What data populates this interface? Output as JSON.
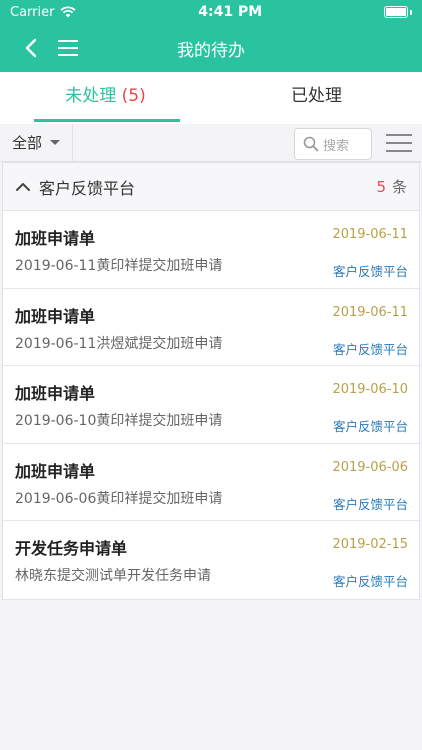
{
  "status_bar": {
    "carrier": "Carrier",
    "time": "4:41 PM"
  },
  "nav": {
    "title": "我的待办"
  },
  "tabs": [
    {
      "label": "未处理",
      "count": "(5)"
    },
    {
      "label": "已处理"
    }
  ],
  "filter": {
    "selected": "全部",
    "search_placeholder": "搜索"
  },
  "group": {
    "title": "客户反馈平台",
    "count": "5",
    "count_unit": "条",
    "items": [
      {
        "title": "加班申请单",
        "date": "2019-06-11",
        "desc": "2019-06-11黄印祥提交加班申请",
        "source": "客户反馈平台"
      },
      {
        "title": "加班申请单",
        "date": "2019-06-11",
        "desc": "2019-06-11洪煜斌提交加班申请",
        "source": "客户反馈平台"
      },
      {
        "title": "加班申请单",
        "date": "2019-06-10",
        "desc": "2019-06-10黄印祥提交加班申请",
        "source": "客户反馈平台"
      },
      {
        "title": "加班申请单",
        "date": "2019-06-06",
        "desc": "2019-06-06黄印祥提交加班申请",
        "source": "客户反馈平台"
      },
      {
        "title": "开发任务申请单",
        "date": "2019-02-15",
        "desc": "林晓东提交测试单开发任务申请",
        "source": "客户反馈平台"
      }
    ]
  },
  "colors": {
    "brand": "#2ac3a0",
    "count_red": "#e84a4a",
    "date_gold": "#b8a14a",
    "source_blue": "#2a7ab8"
  }
}
